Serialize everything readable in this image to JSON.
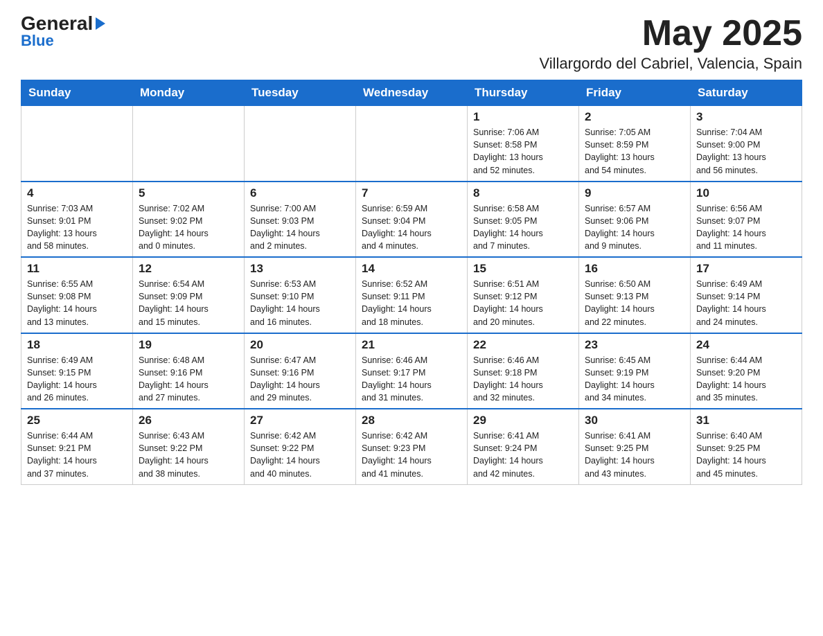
{
  "header": {
    "logo_line1": "General",
    "logo_line2": "Blue",
    "month": "May 2025",
    "location": "Villargordo del Cabriel, Valencia, Spain"
  },
  "days_of_week": [
    "Sunday",
    "Monday",
    "Tuesday",
    "Wednesday",
    "Thursday",
    "Friday",
    "Saturday"
  ],
  "weeks": [
    [
      {
        "day": "",
        "info": ""
      },
      {
        "day": "",
        "info": ""
      },
      {
        "day": "",
        "info": ""
      },
      {
        "day": "",
        "info": ""
      },
      {
        "day": "1",
        "info": "Sunrise: 7:06 AM\nSunset: 8:58 PM\nDaylight: 13 hours\nand 52 minutes."
      },
      {
        "day": "2",
        "info": "Sunrise: 7:05 AM\nSunset: 8:59 PM\nDaylight: 13 hours\nand 54 minutes."
      },
      {
        "day": "3",
        "info": "Sunrise: 7:04 AM\nSunset: 9:00 PM\nDaylight: 13 hours\nand 56 minutes."
      }
    ],
    [
      {
        "day": "4",
        "info": "Sunrise: 7:03 AM\nSunset: 9:01 PM\nDaylight: 13 hours\nand 58 minutes."
      },
      {
        "day": "5",
        "info": "Sunrise: 7:02 AM\nSunset: 9:02 PM\nDaylight: 14 hours\nand 0 minutes."
      },
      {
        "day": "6",
        "info": "Sunrise: 7:00 AM\nSunset: 9:03 PM\nDaylight: 14 hours\nand 2 minutes."
      },
      {
        "day": "7",
        "info": "Sunrise: 6:59 AM\nSunset: 9:04 PM\nDaylight: 14 hours\nand 4 minutes."
      },
      {
        "day": "8",
        "info": "Sunrise: 6:58 AM\nSunset: 9:05 PM\nDaylight: 14 hours\nand 7 minutes."
      },
      {
        "day": "9",
        "info": "Sunrise: 6:57 AM\nSunset: 9:06 PM\nDaylight: 14 hours\nand 9 minutes."
      },
      {
        "day": "10",
        "info": "Sunrise: 6:56 AM\nSunset: 9:07 PM\nDaylight: 14 hours\nand 11 minutes."
      }
    ],
    [
      {
        "day": "11",
        "info": "Sunrise: 6:55 AM\nSunset: 9:08 PM\nDaylight: 14 hours\nand 13 minutes."
      },
      {
        "day": "12",
        "info": "Sunrise: 6:54 AM\nSunset: 9:09 PM\nDaylight: 14 hours\nand 15 minutes."
      },
      {
        "day": "13",
        "info": "Sunrise: 6:53 AM\nSunset: 9:10 PM\nDaylight: 14 hours\nand 16 minutes."
      },
      {
        "day": "14",
        "info": "Sunrise: 6:52 AM\nSunset: 9:11 PM\nDaylight: 14 hours\nand 18 minutes."
      },
      {
        "day": "15",
        "info": "Sunrise: 6:51 AM\nSunset: 9:12 PM\nDaylight: 14 hours\nand 20 minutes."
      },
      {
        "day": "16",
        "info": "Sunrise: 6:50 AM\nSunset: 9:13 PM\nDaylight: 14 hours\nand 22 minutes."
      },
      {
        "day": "17",
        "info": "Sunrise: 6:49 AM\nSunset: 9:14 PM\nDaylight: 14 hours\nand 24 minutes."
      }
    ],
    [
      {
        "day": "18",
        "info": "Sunrise: 6:49 AM\nSunset: 9:15 PM\nDaylight: 14 hours\nand 26 minutes."
      },
      {
        "day": "19",
        "info": "Sunrise: 6:48 AM\nSunset: 9:16 PM\nDaylight: 14 hours\nand 27 minutes."
      },
      {
        "day": "20",
        "info": "Sunrise: 6:47 AM\nSunset: 9:16 PM\nDaylight: 14 hours\nand 29 minutes."
      },
      {
        "day": "21",
        "info": "Sunrise: 6:46 AM\nSunset: 9:17 PM\nDaylight: 14 hours\nand 31 minutes."
      },
      {
        "day": "22",
        "info": "Sunrise: 6:46 AM\nSunset: 9:18 PM\nDaylight: 14 hours\nand 32 minutes."
      },
      {
        "day": "23",
        "info": "Sunrise: 6:45 AM\nSunset: 9:19 PM\nDaylight: 14 hours\nand 34 minutes."
      },
      {
        "day": "24",
        "info": "Sunrise: 6:44 AM\nSunset: 9:20 PM\nDaylight: 14 hours\nand 35 minutes."
      }
    ],
    [
      {
        "day": "25",
        "info": "Sunrise: 6:44 AM\nSunset: 9:21 PM\nDaylight: 14 hours\nand 37 minutes."
      },
      {
        "day": "26",
        "info": "Sunrise: 6:43 AM\nSunset: 9:22 PM\nDaylight: 14 hours\nand 38 minutes."
      },
      {
        "day": "27",
        "info": "Sunrise: 6:42 AM\nSunset: 9:22 PM\nDaylight: 14 hours\nand 40 minutes."
      },
      {
        "day": "28",
        "info": "Sunrise: 6:42 AM\nSunset: 9:23 PM\nDaylight: 14 hours\nand 41 minutes."
      },
      {
        "day": "29",
        "info": "Sunrise: 6:41 AM\nSunset: 9:24 PM\nDaylight: 14 hours\nand 42 minutes."
      },
      {
        "day": "30",
        "info": "Sunrise: 6:41 AM\nSunset: 9:25 PM\nDaylight: 14 hours\nand 43 minutes."
      },
      {
        "day": "31",
        "info": "Sunrise: 6:40 AM\nSunset: 9:25 PM\nDaylight: 14 hours\nand 45 minutes."
      }
    ]
  ]
}
